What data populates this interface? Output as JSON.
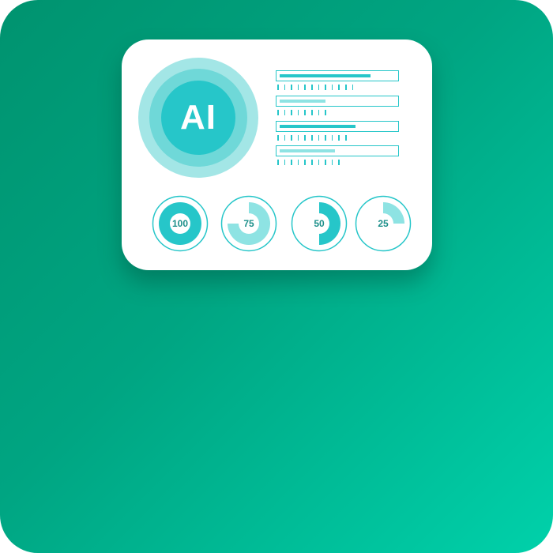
{
  "ai_badge": {
    "label": "AI",
    "colors": {
      "outer": "#a3e6e6",
      "middle": "#6fd8d8",
      "inner": "#26c6c9",
      "text": "#ffffff"
    }
  },
  "progress_bars": [
    {
      "fill": 0.78,
      "color": "#26c6c9",
      "ticks": 12
    },
    {
      "fill": 0.39,
      "color": "#8ee3e3",
      "ticks": 8
    },
    {
      "fill": 0.65,
      "color": "#26c6c9",
      "ticks": 11
    },
    {
      "fill": 0.47,
      "color": "#8ee3e3",
      "ticks": 10
    }
  ],
  "gauges": [
    {
      "label": "100",
      "value": 100,
      "color": "#26c6c9"
    },
    {
      "label": "75",
      "value": 75,
      "color": "#8ee3e3"
    },
    {
      "label": "50",
      "value": 50,
      "color": "#26c6c9"
    },
    {
      "label": "25",
      "value": 25,
      "color": "#8ee3e3"
    }
  ],
  "theme": {
    "background_gradient": [
      "#00936f",
      "#00d1aa"
    ],
    "card": "#ffffff",
    "outline": "#26c6c9"
  }
}
